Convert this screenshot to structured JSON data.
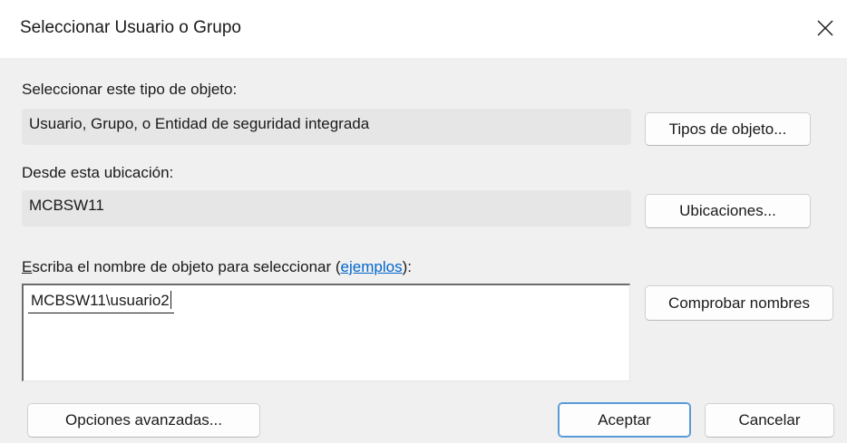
{
  "window": {
    "title": "Seleccionar Usuario o Grupo",
    "close_glyph": "✕"
  },
  "object_type": {
    "label": "Seleccionar este tipo de objeto:",
    "value": "Usuario, Grupo, o Entidad de seguridad integrada",
    "button": "Tipos de objeto..."
  },
  "location": {
    "label": "Desde esta ubicación:",
    "value": "MCBSW11",
    "button": "Ubicaciones..."
  },
  "names": {
    "label_mnemonic": "E",
    "label_before": "scriba el nombre de objeto para seleccionar (",
    "examples_link": "ejemplos",
    "label_after": "):",
    "value": "MCBSW11\\usuario2",
    "button": "Comprobar nombres"
  },
  "footer": {
    "advanced_button": "Opciones avanzadas...",
    "ok_button": "Aceptar",
    "cancel_button": "Cancelar"
  },
  "colors": {
    "accent": "#0066cc",
    "default_button_border": "#5a9ad8"
  }
}
